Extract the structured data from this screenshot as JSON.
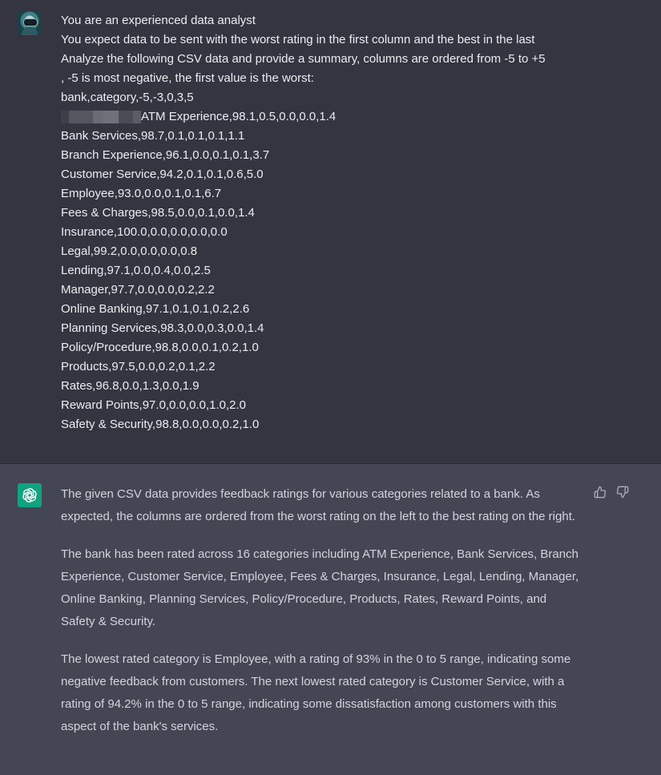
{
  "user_message": {
    "lines": [
      "You are an experienced data analyst",
      "You expect data to be sent with the worst rating in the first column and the best in the last",
      "Analyze the following CSV data and provide a summary, columns are ordered from -5 to +5",
      ", -5 is most negative, the first value is the worst:",
      "bank,category,-5,-3,0,3,5",
      "ATM Experience,98.1,0.5,0.0,0.0,1.4",
      "Bank Services,98.7,0.1,0.1,0.1,1.1",
      "Branch Experience,96.1,0.0,0.1,0.1,3.7",
      "Customer Service,94.2,0.1,0.1,0.6,5.0",
      "Employee,93.0,0.0,0.1,0.1,6.7",
      "Fees & Charges,98.5,0.0,0.1,0.0,1.4",
      "Insurance,100.0,0.0,0.0,0.0,0.0",
      "Legal,99.2,0.0,0.0,0.0,0.8",
      "Lending,97.1,0.0,0.4,0.0,2.5",
      "Manager,97.7,0.0,0.0,0.2,2.2",
      "Online Banking,97.1,0.1,0.1,0.2,2.6",
      "Planning Services,98.3,0.0,0.3,0.0,1.4",
      "Policy/Procedure,98.8,0.0,0.1,0.2,1.0",
      "Products,97.5,0.0,0.2,0.1,2.2",
      "Rates,96.8,0.0,1.3,0.0,1.9",
      "Reward Points,97.0,0.0,0.0,1.0,2.0",
      "Safety & Security,98.8,0.0,0.0,0.2,1.0"
    ]
  },
  "assistant_message": {
    "paragraphs": [
      "The given CSV data provides feedback ratings for various categories related to a bank. As expected, the columns are ordered from the worst rating on the left to the best rating on the right.",
      "The bank has been rated across 16 categories including ATM Experience, Bank Services, Branch Experience, Customer Service, Employee, Fees & Charges, Insurance, Legal, Lending, Manager, Online Banking, Planning Services, Policy/Procedure, Products, Rates, Reward Points, and Safety & Security.",
      "The lowest rated category is Employee, with a rating of 93% in the 0 to 5 range, indicating some negative feedback from customers. The next lowest rated category is Customer Service, with a rating of 94.2% in the 0 to 5 range, indicating some dissatisfaction among customers with this aspect of the bank's services."
    ]
  },
  "icons": {
    "user_avatar": "user-avatar-image",
    "assistant_avatar": "openai-logo-icon",
    "thumbs_up": "thumbs-up-icon",
    "thumbs_down": "thumbs-down-icon"
  },
  "colors": {
    "user_bg": "#343541",
    "assistant_bg": "#444654",
    "assistant_avatar_bg": "#10a37f"
  }
}
